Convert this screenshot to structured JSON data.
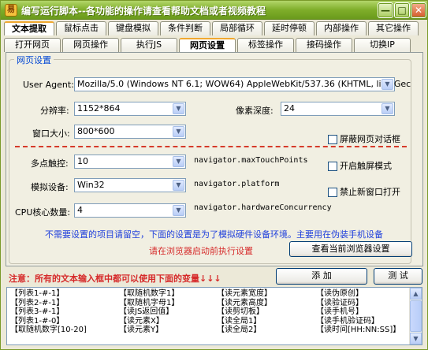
{
  "window": {
    "title": "编写运行脚本--各功能的操作请查看帮助文档或者视频教程",
    "icon_label": "易",
    "min_glyph": "—",
    "max_glyph": "□",
    "close_glyph": "✕"
  },
  "tabs_row1": [
    "文本提取",
    "鼠标点击",
    "键盘模拟",
    "条件判断",
    "局部循环",
    "延时停顿",
    "内部操作",
    "其它操作"
  ],
  "tabs_row1_active": 0,
  "tabs_row2": [
    "打开网页",
    "网页操作",
    "执行JS",
    "网页设置",
    "标签操作",
    "接码操作",
    "切换IP"
  ],
  "tabs_row2_active": 3,
  "settings": {
    "group_title": "网页设置",
    "user_agent_label": "User Agent:",
    "user_agent_value": "Mozilla/5.0 (Windows NT 6.1; WOW64) AppleWebKit/537.36 (KHTML, like Gec",
    "resolution_label": "分辨率:",
    "resolution_value": "1152*864",
    "depth_label": "像素深度:",
    "depth_value": "24",
    "window_size_label": "窗口大小:",
    "window_size_value": "800*600",
    "block_dialog_label": "屏蔽网页对话框",
    "touch_label": "多点触控:",
    "touch_value": "10",
    "touch_hint": "navigator.maxTouchPoints",
    "enable_touch_label": "开启触屏模式",
    "device_label": "模拟设备:",
    "device_value": "Win32",
    "device_hint": "navigator.platform",
    "block_newwin_label": "禁止新窗口打开",
    "cpu_label": "CPU核心数量:",
    "cpu_value": "4",
    "cpu_hint": "navigator.hardwareConcurrency",
    "blue_note": "不需要设置的项目请留空，下面的设置是为了模拟硬件设备环境。主要用在伪装手机设备",
    "red_note": "请在浏览器启动前执行设置",
    "view_browser_button": "查看当前浏览器设置"
  },
  "footer": {
    "notice": "注意：所有的文本输入框中都可以使用下面的变量↓↓↓",
    "add_button": "添 加",
    "test_button": "测 试"
  },
  "variables": [
    [
      "【列表1-#-1】",
      "【列表2-#-1】",
      "【列表3-#-1】",
      "【列表1-#-0】",
      "【取随机数字[10-20]"
    ],
    [
      "【取随机数字1】",
      "【取随机字母1】",
      "【读JS返回值】",
      "【读元素X】",
      "【读元素Y】"
    ],
    [
      "【读元素宽度】",
      "【读元素高度】",
      "【读剪切板】",
      "【读全局1】",
      "【读全局2】"
    ],
    [
      "【读伪原创】",
      "【读验证码】",
      "【读手机号】",
      "【读手机验证码】",
      "【读时间[HH:NN:SS]】"
    ]
  ],
  "scroll": {
    "up": "▲",
    "down": "▼"
  },
  "combo_arrow": "▼"
}
